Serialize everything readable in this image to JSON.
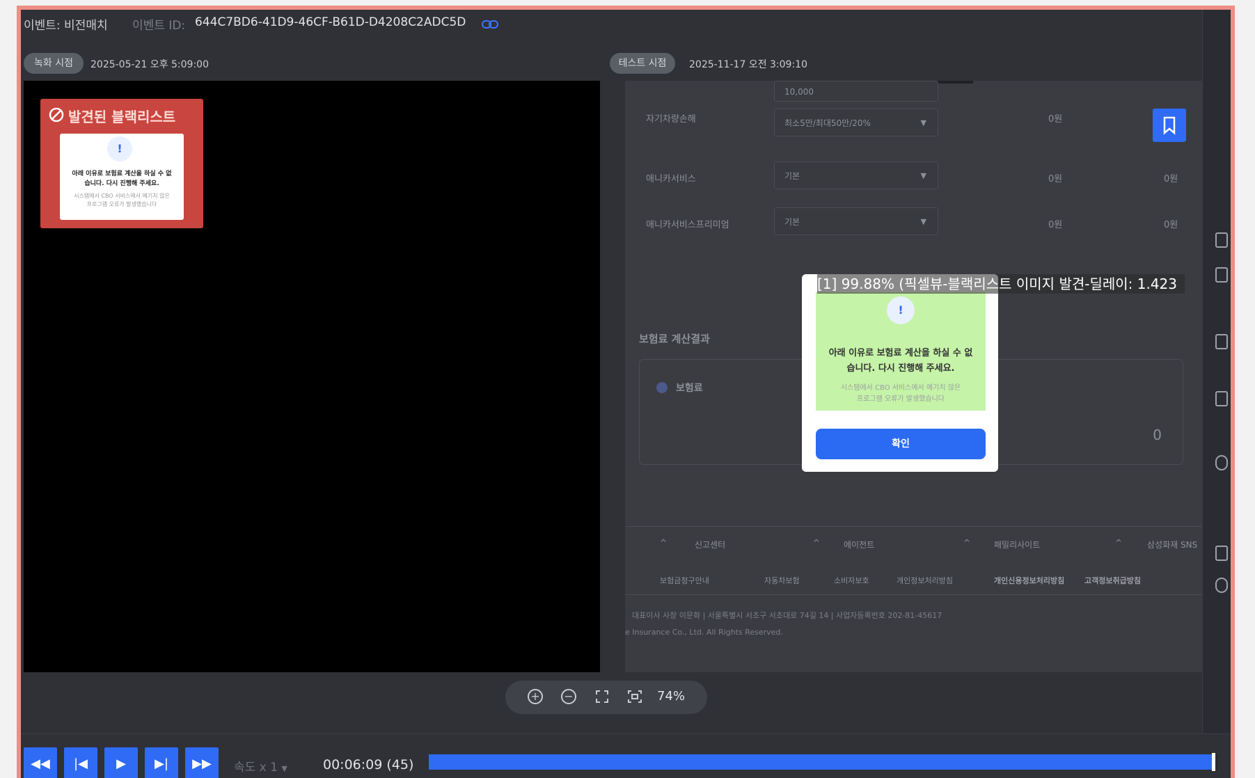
{
  "header": {
    "event_label": "이벤트: 비전매치",
    "event_id_label": "이벤트 ID:",
    "event_id": "644C7BD6-41D9-46CF-B61D-D4208C2ADC5D"
  },
  "recording": {
    "pill": "녹화 시점",
    "time": "2025-05-21 오후 5:09:00"
  },
  "testing": {
    "pill": "테스트 시점",
    "time": "2025-11-17 오전 3:09:10"
  },
  "blacklist_card": {
    "title": "발견된 블랙리스트",
    "line1": "아래 이유로 보험료 계산을 하실 수 없",
    "line2": "습니다. 다시 진행해 주세요.",
    "sub1": "시스템에서 CBO 서비스에서 예기치 않은",
    "sub2": "프로그램 오류가 발생했습니다"
  },
  "form": {
    "top_value": "10,000",
    "rows": [
      {
        "label": "자기차량손해",
        "field": "최소5만/최대50만/20%",
        "v1": "0원",
        "v2": ""
      },
      {
        "label": "애니카서비스",
        "field": "기본",
        "v1": "0원",
        "v2": "0원"
      },
      {
        "label": "애니카서비스프리미엄",
        "field": "기본",
        "v1": "0원",
        "v2": "0원"
      }
    ],
    "result_title": "보험료 계산결과",
    "result_item": "보험료",
    "result_value": "0"
  },
  "footer": {
    "cols": [
      "신고센터",
      "에이전트",
      "패밀리사이트",
      "삼성화재 SNS"
    ],
    "links": [
      "보험금청구안내",
      "자동차보험",
      "소비자보호",
      "개인정보처리방침",
      "개인신용정보처리방침",
      "고객정보취급방침"
    ],
    "address": "대표이사 사장 이문화 | 서울특별시 서초구 서초대로 74길 14 | 사업자등록번호 202-81-45617",
    "copyright": "e Insurance Co., Ltd. All Rights Reserved."
  },
  "popup": {
    "line1": "아래 이유로 보험료 계산을 하실 수 없",
    "line2": "습니다. 다시 진행해 주세요.",
    "sub1": "시스템에서 CBO 서비스에서 예기치 않은",
    "sub2": "프로그램 오류가 발생했습니다",
    "button": "확인"
  },
  "match_label": "[1] 99.88% (픽셀뷰-블랙리스트 이미지 발견-딜레이: 1.423",
  "zoom": {
    "percent": "74%"
  },
  "player": {
    "speed": "속도 x 1",
    "time": "00:06:09 (45)",
    "progress": 0.995
  },
  "colors": {
    "accent": "#2f6bf5",
    "frame": "#ee8e85",
    "blacklist": "#c9453f",
    "match": "#c5f3a8"
  }
}
